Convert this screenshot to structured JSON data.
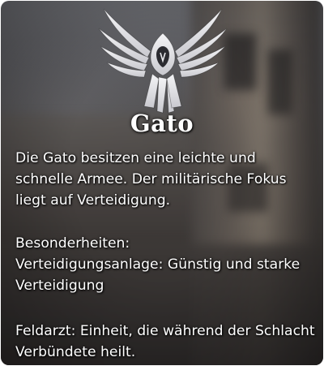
{
  "faction": {
    "emblem_icon": "winged-shield-emblem-icon",
    "name": "Gato",
    "description": "Die Gato besitzen eine leichte und schnelle Armee. Der militärische Fokus liegt auf Verteidigung.",
    "specials_heading": "Besonderheiten:",
    "specials": [
      "Verteidigungsanlage: Günstig und starke Verteidigung",
      "Feldarzt: Einheit, die während der Schlacht Verbündete heilt."
    ]
  },
  "colors": {
    "text": "#ffffff",
    "emblem": "#e8e8ec",
    "emblem_center": "#2b2b30"
  }
}
